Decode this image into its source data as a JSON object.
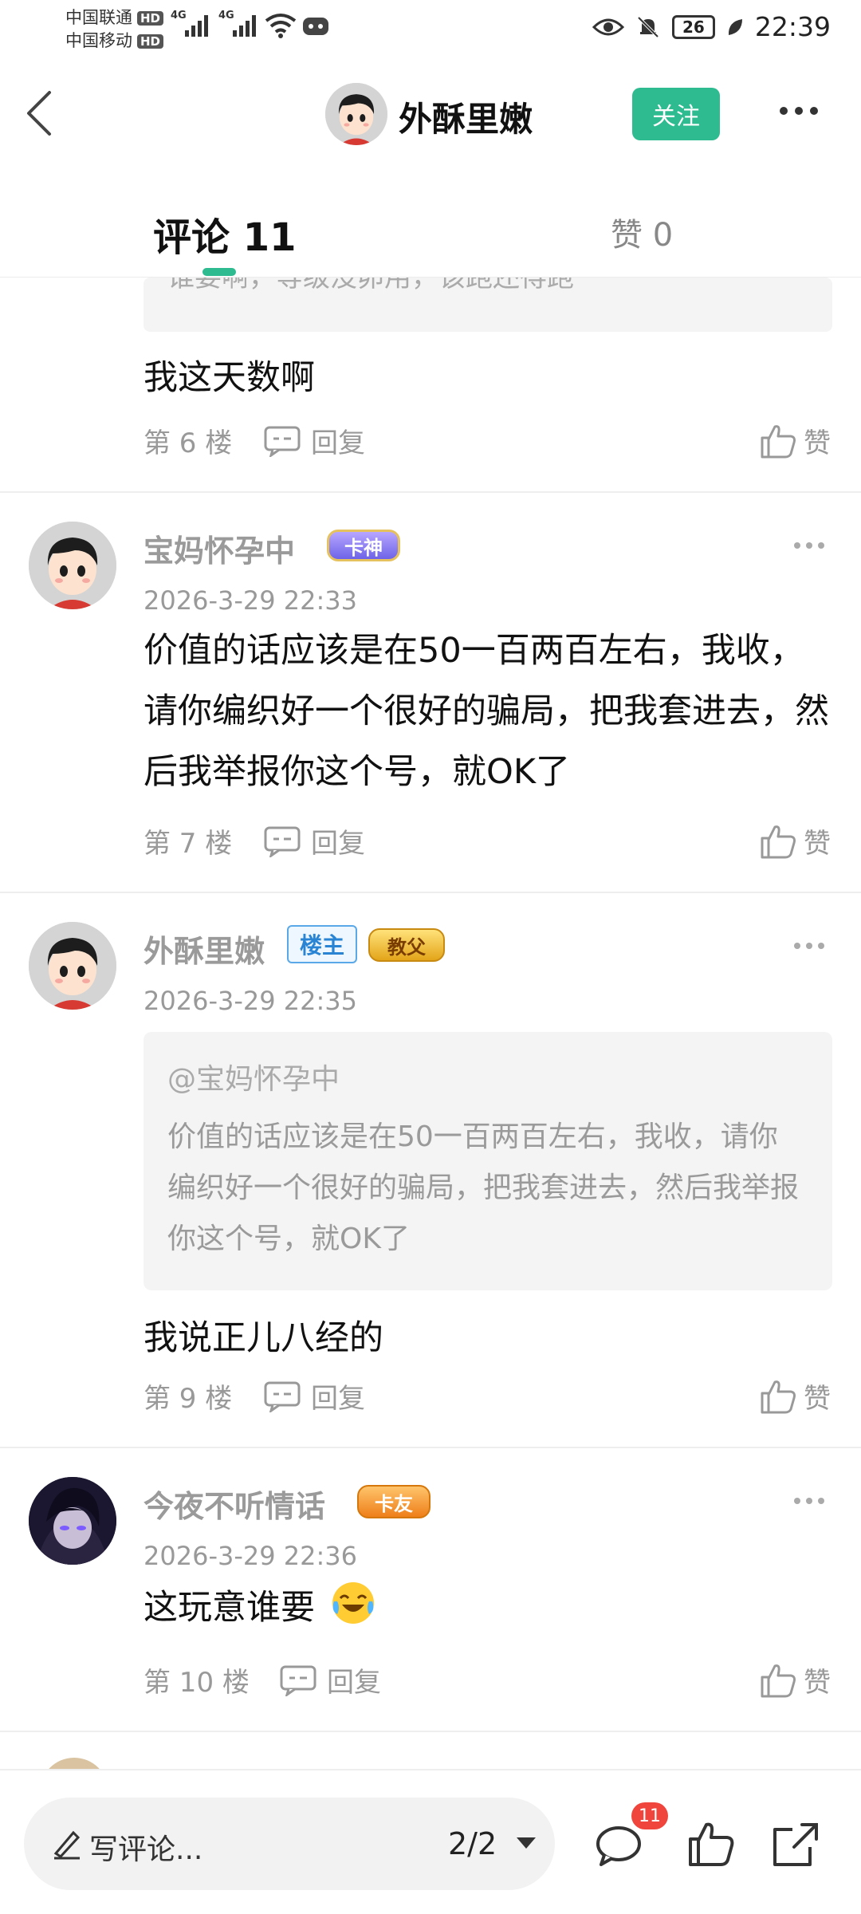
{
  "status_bar": {
    "carrier1": "中国联通",
    "carrier2": "中国移动",
    "hd": "HD",
    "net1": "4G",
    "net2": "4G",
    "battery": "26",
    "time": "22:39"
  },
  "header": {
    "author_name": "外酥里嫩",
    "follow_label": "关注"
  },
  "tabs": {
    "comments_label": "评论 11",
    "likes_label": "赞 0"
  },
  "comments": [
    {
      "cut_quote": "谁要啊，等级没卵用，该跑还得跑",
      "text": "我这天数啊",
      "floor": "第 6 楼",
      "reply": "回复",
      "like": "赞"
    },
    {
      "name": "宝妈怀孕中",
      "badge": "卡神",
      "time": "2026-3-29 22:33",
      "text": "价值的话应该是在50一百两百左右，我收，请你编织好一个很好的骗局，把我套进去，然后我举报你这个号，就OK了",
      "floor": "第 7 楼",
      "reply": "回复",
      "like": "赞"
    },
    {
      "name": "外酥里嫩",
      "owner_badge": "楼主",
      "badge": "教父",
      "time": "2026-3-29 22:35",
      "quote_at": "@宝妈怀孕中",
      "quote_text": "价值的话应该是在50一百两百左右，我收，请你编织好一个很好的骗局，把我套进去，然后我举报你这个号，就OK了",
      "text": "我说正儿八经的",
      "floor": "第 9 楼",
      "reply": "回复",
      "like": "赞"
    },
    {
      "name": "今夜不听情话",
      "badge": "卡友",
      "time": "2026-3-29 22:36",
      "text": "这玩意谁要",
      "floor": "第 10 楼",
      "reply": "回复",
      "like": "赞"
    }
  ],
  "bottom_bar": {
    "input_placeholder": "写评论...",
    "page_indicator": "2/2",
    "comment_count": "11"
  },
  "colors": {
    "accent": "#2dbb8f",
    "badge_red": "#f0453d",
    "muted": "#999999"
  },
  "icons": [
    "back-icon",
    "more-icon",
    "comment-icon",
    "reply-icon",
    "thumb-up-icon",
    "share-icon",
    "pen-icon",
    "laugh-cry-emoji-icon"
  ]
}
